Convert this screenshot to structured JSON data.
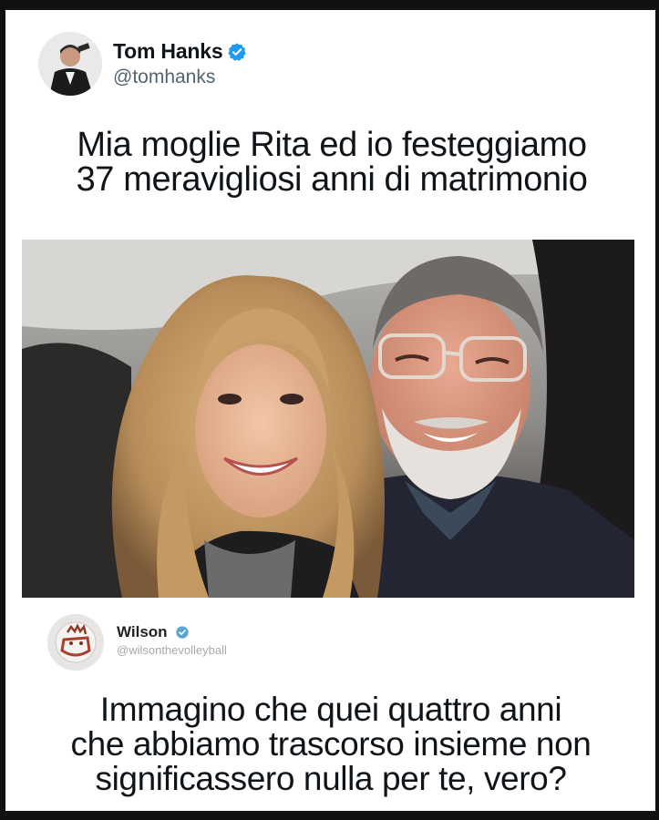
{
  "tweet": {
    "author_name": "Tom Hanks",
    "author_handle": "@tomhanks",
    "text_line1": "Mia moglie Rita ed io festeggiamo",
    "text_line2": "37 meravigliosi anni di matrimonio",
    "verified_color": "#1d9bf0"
  },
  "photo": {
    "icon": "couple-selfie-photo"
  },
  "reply": {
    "author_name": "Wilson",
    "author_handle": "@wilsonthevolleyball",
    "text_line1": "Immagino che quei quattro anni",
    "text_line2": "che abbiamo trascorso insieme non",
    "text_line3": "significassero nulla per te, vero?",
    "verified_color": "#5aa4d6"
  }
}
